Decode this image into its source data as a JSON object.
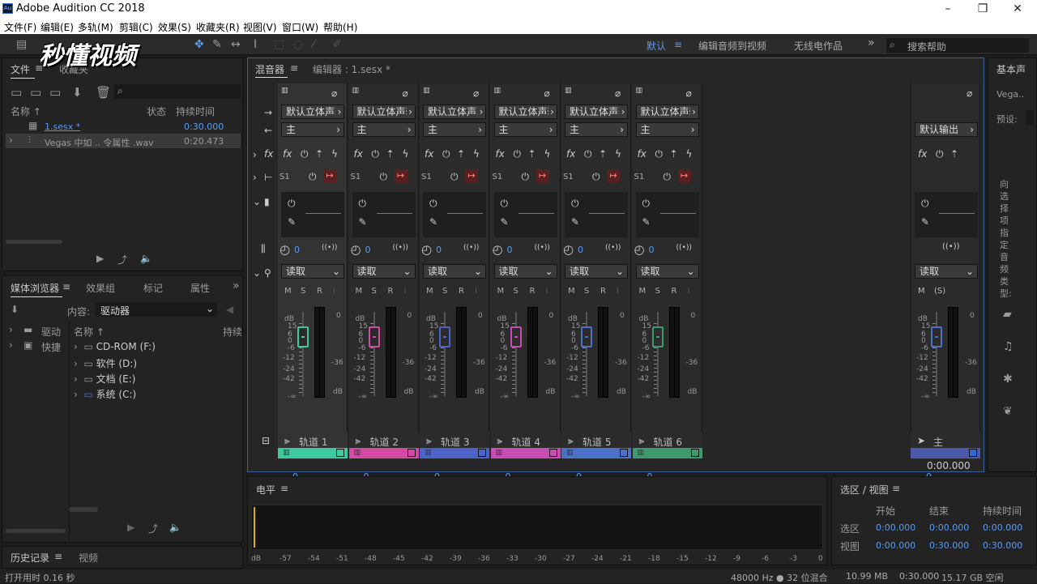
{
  "window": {
    "title": "Adobe Audition CC 2018",
    "app_icon": "Au"
  },
  "watermark": "秒懂视频",
  "menu": [
    "文件(F)",
    "编辑(E)",
    "多轨(M)",
    "剪辑(C)",
    "效果(S)",
    "收藏夹(R)",
    "视图(V)",
    "窗口(W)",
    "帮助(H)"
  ],
  "workspaces": {
    "active": "默认",
    "items": [
      "编辑音频到视频",
      "无线电作品"
    ],
    "more": "»"
  },
  "search": {
    "placeholder": "搜索帮助"
  },
  "files_panel": {
    "tab_files": "文件",
    "tab_favorites": "收藏夹",
    "col_name": "名称 ↑",
    "col_status": "状态",
    "col_duration": "持续时间",
    "rows": [
      {
        "name": "1.sesx *",
        "duration": "0:30.000"
      },
      {
        "name": "Vegas 中如 .. 令属性 .wav",
        "duration": "0:20.473"
      }
    ]
  },
  "media_panel": {
    "tabs": [
      "媒体浏览器",
      "效果组",
      "标记",
      "属性"
    ],
    "content_label": "内容:",
    "content_value": "驱动器",
    "col_name": "名称 ↑",
    "col_duration": "持续",
    "left_items": [
      "驱动",
      "快捷"
    ],
    "drives": [
      "CD-ROM (F:)",
      "软件 (D:)",
      "文档 (E:)",
      "系统 (C:)"
    ]
  },
  "history_panel": {
    "tabs": [
      "历史记录",
      "视频"
    ]
  },
  "mixer": {
    "tab": "混音器",
    "editor_tab": "编辑器 : 1.sesx *",
    "input": "默认立体声输入",
    "output": "主",
    "send": "S1",
    "read": "读取",
    "msr": [
      "M",
      "S",
      "R",
      "I"
    ],
    "pan": "0",
    "volume": "0",
    "scale_left": [
      "dB",
      "15",
      "6",
      "0",
      "-6",
      "-12",
      "-24",
      "-42",
      "-∞"
    ],
    "scale_right": [
      "0",
      "-36",
      "dB"
    ],
    "tracks": [
      {
        "name": "轨道 1",
        "color": "#3ec99e"
      },
      {
        "name": "轨道 2",
        "color": "#d24aa3"
      },
      {
        "name": "轨道 3",
        "color": "#4d63c8"
      },
      {
        "name": "轨道 4",
        "color": "#c84cb2"
      },
      {
        "name": "轨道 5",
        "color": "#4b72c8"
      },
      {
        "name": "轨道 6",
        "color": "#3f9a6d"
      }
    ],
    "master": {
      "output": "默认输出",
      "name": "主",
      "volume": "0",
      "time": "0:00.000",
      "color": "#4b5aa8"
    }
  },
  "props_panel": {
    "title": "基本声",
    "vegas": "Vega..",
    "preset": "预设:",
    "hint": "向选择项指定音频类型:"
  },
  "level_panel": {
    "title": "电平",
    "ticks": [
      "dB",
      "-57",
      "-54",
      "-51",
      "-48",
      "-45",
      "-42",
      "-39",
      "-36",
      "-33",
      "-30",
      "-27",
      "-24",
      "-21",
      "-18",
      "-15",
      "-12",
      "-9",
      "-6",
      "-3",
      "0"
    ]
  },
  "selview_panel": {
    "title": "选区 / 视图",
    "cols": [
      "开始",
      "结束",
      "持续时间"
    ],
    "rows": [
      {
        "label": "选区",
        "start": "0:00.000",
        "end": "0:00.000",
        "dur": "0:00.000"
      },
      {
        "label": "视图",
        "start": "0:00.000",
        "end": "0:30.000",
        "dur": "0:30.000"
      }
    ]
  },
  "status": {
    "left": "打开用时 0.16 秒",
    "rate": "48000 Hz ● 32 位混合",
    "size": "10.99 MB",
    "time": "0:30.000",
    "free": "15.17 GB 空闲"
  }
}
